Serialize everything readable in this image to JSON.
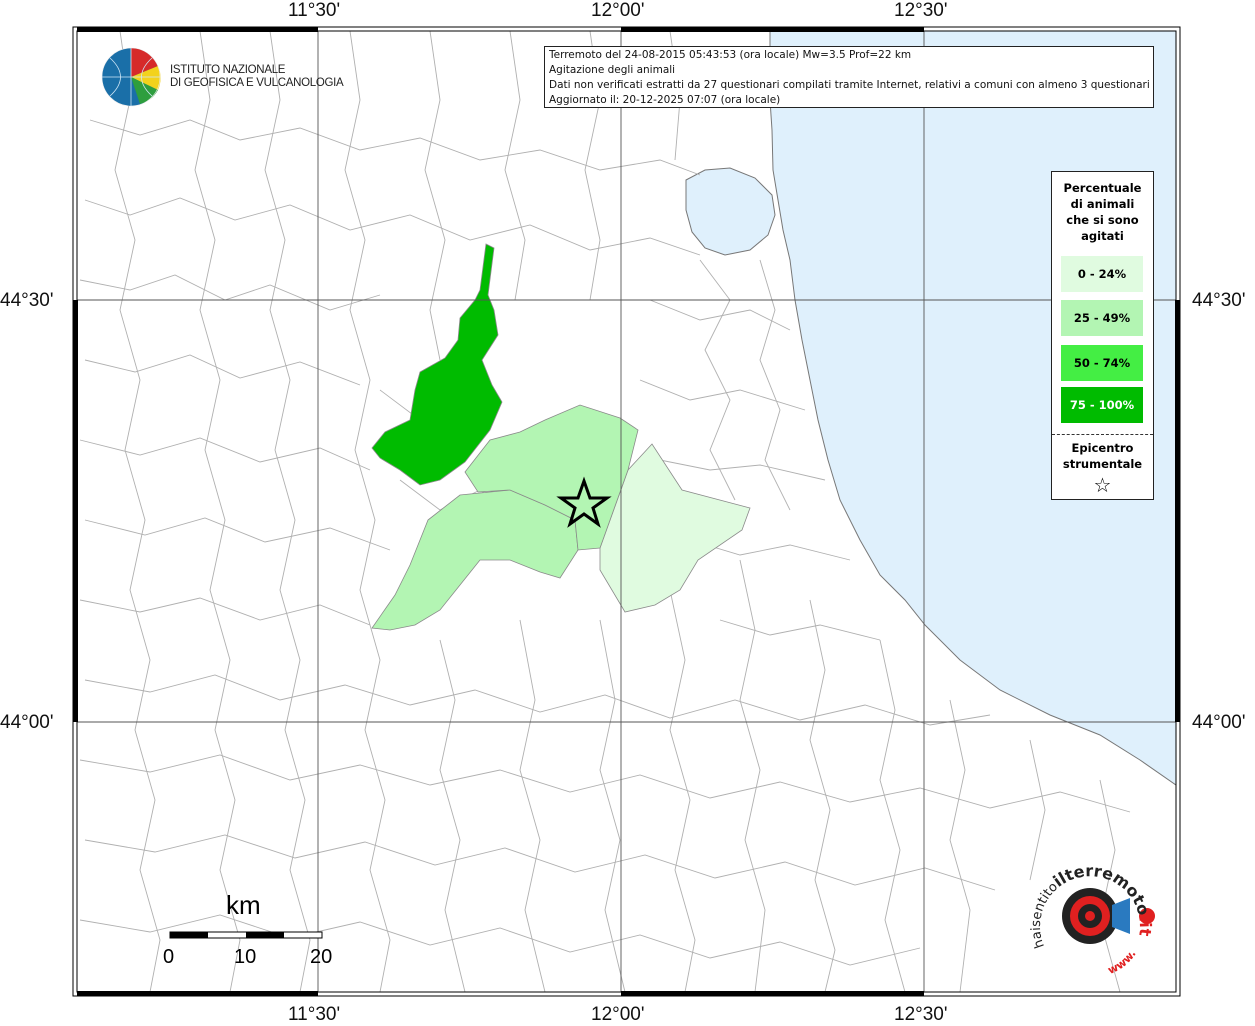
{
  "info": {
    "line1": "Terremoto del 24-08-2015 05:43:53 (ora locale) Mw=3.5 Prof=22 km",
    "line2": "Agitazione degli animali",
    "line3": "Dati non verificati estratti da 27 questionari compilati tramite Internet, relativi a comuni con almeno 3 questionari.",
    "line4": "Aggiornato il: 20-12-2025 07:07 (ora locale)"
  },
  "institute": {
    "name_line1": "ISTITUTO NAZIONALE",
    "name_line2": "DI GEOFISICA E VULCANOLOGIA"
  },
  "axes": {
    "lon_ticks": [
      "11°30'",
      "12°00'",
      "12°30'"
    ],
    "lat_ticks": [
      "44°30'",
      "44°00'"
    ]
  },
  "legend": {
    "title_lines": [
      "Percentuale",
      "di animali",
      "che si sono",
      "agitati"
    ],
    "classes": [
      {
        "label": "0 - 24%",
        "color": "#e0fbe0"
      },
      {
        "label": "25 - 49%",
        "color": "#b3f5b3"
      },
      {
        "label": "50 - 74%",
        "color": "#44ee44"
      },
      {
        "label": "75 - 100%",
        "color": "#00bb00"
      }
    ],
    "epicenter_line1": "Epicentro",
    "epicenter_line2": "strumentale",
    "epicenter_symbol": "☆"
  },
  "scale_bar": {
    "unit": "km",
    "labels": [
      "0",
      "10",
      "20"
    ]
  },
  "watermark": {
    "text_prefix": "haisentito",
    "text_main": "ilterremoto",
    "text_suffix": ".it",
    "text_www": "www."
  },
  "colors": {
    "sea": "#dff0fc",
    "border": "#aaaaaa",
    "grid": "#555555"
  }
}
